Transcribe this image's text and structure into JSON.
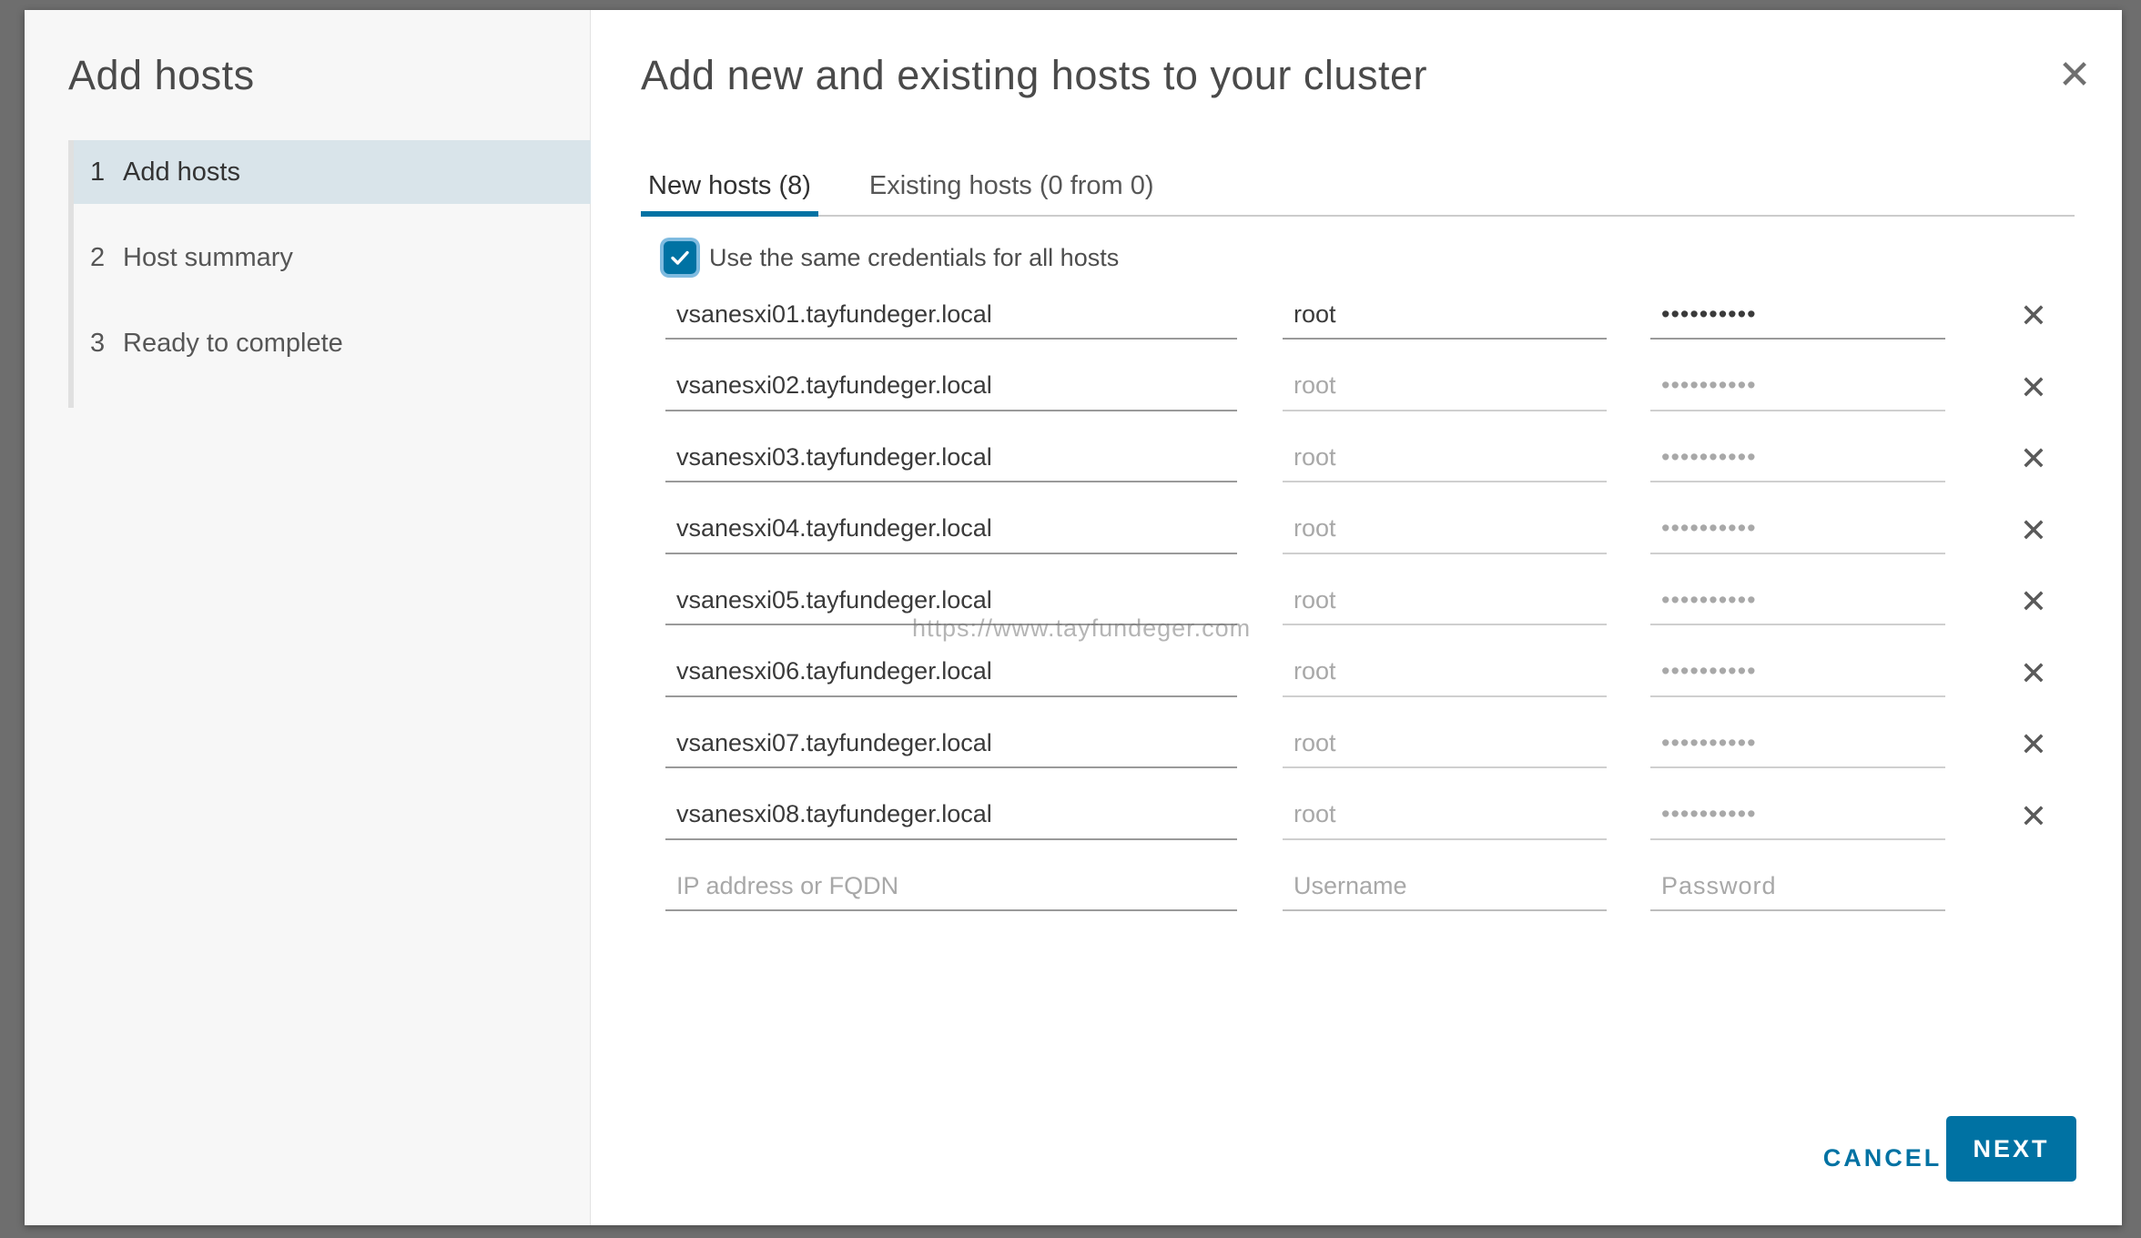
{
  "sidebar": {
    "title": "Add hosts",
    "steps": [
      {
        "number": "1",
        "label": "Add hosts",
        "active": true
      },
      {
        "number": "2",
        "label": "Host summary",
        "active": false
      },
      {
        "number": "3",
        "label": "Ready to complete",
        "active": false
      }
    ]
  },
  "main": {
    "title": "Add new and existing hosts to your cluster",
    "close_icon": "close-icon",
    "tabs": [
      {
        "label": "New hosts (8)",
        "active": true
      },
      {
        "label": "Existing hosts (0 from 0)",
        "active": false
      }
    ],
    "same_credentials": {
      "label": "Use the same credentials for all hosts",
      "checked": true
    },
    "hosts": [
      {
        "host": "vsanesxi01.tayfundeger.local",
        "username": "root",
        "password": "••••••••••"
      },
      {
        "host": "vsanesxi02.tayfundeger.local",
        "username": "root",
        "password": "••••••••••"
      },
      {
        "host": "vsanesxi03.tayfundeger.local",
        "username": "root",
        "password": "••••••••••"
      },
      {
        "host": "vsanesxi04.tayfundeger.local",
        "username": "root",
        "password": "••••••••••"
      },
      {
        "host": "vsanesxi05.tayfundeger.local",
        "username": "root",
        "password": "••••••••••"
      },
      {
        "host": "vsanesxi06.tayfundeger.local",
        "username": "root",
        "password": "••••••••••"
      },
      {
        "host": "vsanesxi07.tayfundeger.local",
        "username": "root",
        "password": "••••••••••"
      },
      {
        "host": "vsanesxi08.tayfundeger.local",
        "username": "root",
        "password": "••••••••••"
      }
    ],
    "new_row": {
      "host_placeholder": "IP address or FQDN",
      "username_placeholder": "Username",
      "password_placeholder": "Password"
    },
    "watermark": "https://www.tayfundeger.com"
  },
  "footer": {
    "cancel_label": "CANCEL",
    "next_label": "NEXT"
  },
  "colors": {
    "accent": "#0072a3",
    "active_step_bg": "#d9e4ea"
  }
}
